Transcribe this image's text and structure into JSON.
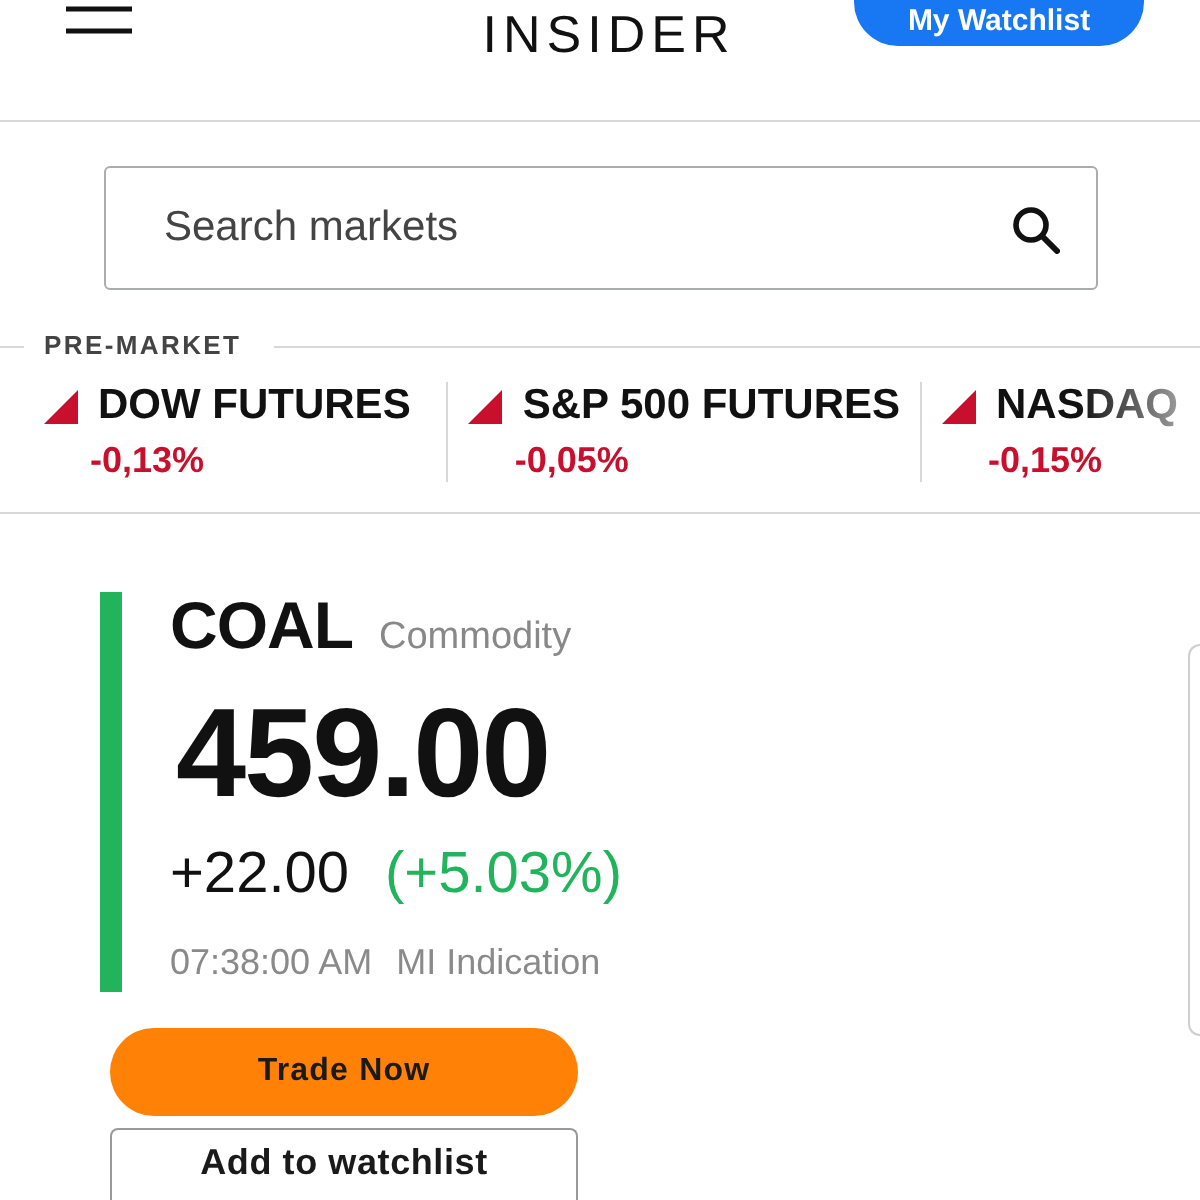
{
  "header": {
    "logo": "INSIDER",
    "watchlist_button": "My Watchlist"
  },
  "search": {
    "placeholder": "Search markets"
  },
  "pre_market": {
    "label": "PRE-MARKET",
    "tickers": [
      {
        "name": "DOW FUTURES",
        "change": "-0,13%",
        "negative": true
      },
      {
        "name": "S&P 500 FUTURES",
        "change": "-0,05%",
        "negative": true
      },
      {
        "name": "NASDAQ",
        "change": "-0,15%",
        "negative": true
      }
    ]
  },
  "quote": {
    "symbol": "COAL",
    "type": "Commodity",
    "price": "459.00",
    "change": "+22.00",
    "change_percent": "(+5.03%)",
    "negative": false,
    "time": "07:38:00 AM",
    "source": "MI Indication"
  },
  "actions": [
    {
      "label": "Trade Now",
      "kind": "primary"
    },
    {
      "label": "Add to watchlist",
      "kind": "secondary"
    }
  ]
}
